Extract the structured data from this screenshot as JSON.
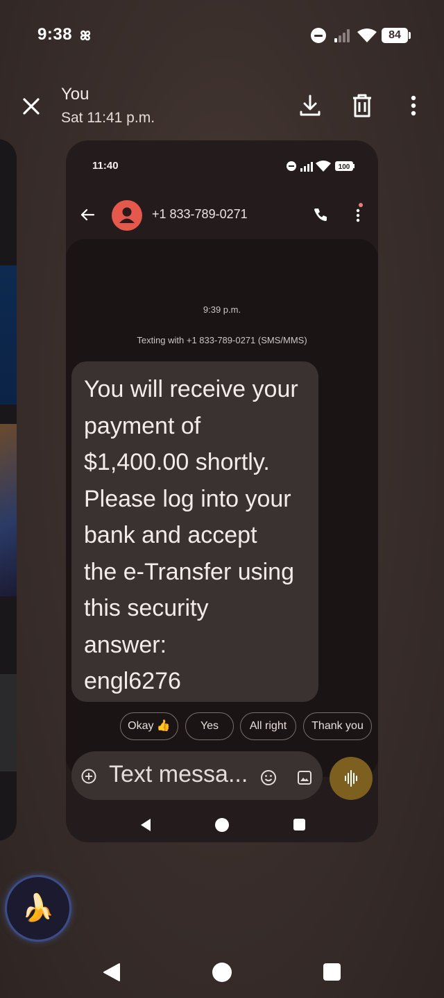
{
  "status_bar": {
    "time": "9:38",
    "battery": "84"
  },
  "header": {
    "title": "You",
    "subtitle": "Sat 11:41 p.m."
  },
  "inner_screen": {
    "status_time": "11:40",
    "battery": "100",
    "contact": "+1 833-789-0271",
    "timestamp": "9:39 p.m.",
    "texting_info": "Texting with +1 833-789-0271 (SMS/MMS)",
    "message_lines": [
      "You will receive your",
      "payment of",
      "$1,400.00 shortly.",
      "Please log into your",
      "bank and accept",
      "the e-Transfer using",
      "this security",
      "answer:",
      "engl6276"
    ],
    "smart_replies": [
      "Okay 👍",
      "Yes",
      "All right",
      "Thank you"
    ],
    "composer_placeholder": "Text messa..."
  },
  "assistant_bubble_icon": "🍌",
  "icons": [
    "pinwheel-icon",
    "dnd-icon",
    "signal-icon",
    "wifi-icon",
    "close-icon",
    "download-icon",
    "trash-icon",
    "more-vert-icon",
    "back-arrow-icon",
    "phone-icon",
    "add-icon",
    "emoji-icon",
    "image-icon",
    "voice-icon"
  ]
}
